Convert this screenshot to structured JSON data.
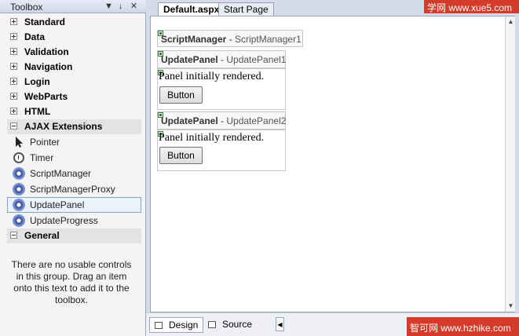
{
  "toolbox": {
    "title": "Toolbox",
    "pin_glyph": "↓",
    "dropdown_glyph": "▼",
    "close_glyph": "✕",
    "categories_top": [
      "Standard",
      "Data",
      "Validation",
      "Navigation",
      "Login",
      "WebParts",
      "HTML"
    ],
    "open_category": "AJAX Extensions",
    "items": [
      "Pointer",
      "Timer",
      "ScriptManager",
      "ScriptManagerProxy",
      "UpdatePanel",
      "UpdateProgress"
    ],
    "selected_item": "UpdatePanel",
    "general_category": "General",
    "empty_message": "There are no usable controls in this group. Drag an item onto this text to add it to the toolbox."
  },
  "tabs": [
    "Default.aspx",
    "Start Page"
  ],
  "watermark_top": "学网  www.xue5.com",
  "designer": {
    "script_manager": {
      "type": "ScriptManager",
      "name": "ScriptManager1"
    },
    "update_panels": [
      {
        "type": "UpdatePanel",
        "name": "UpdatePanel1",
        "text": "Panel initially rendered.",
        "button": "Button"
      },
      {
        "type": "UpdatePanel",
        "name": "UpdatePanel2",
        "text": "Panel initially rendered.",
        "button": "Button"
      }
    ],
    "separator": " - "
  },
  "bottom": {
    "design_label": "Design",
    "source_label": "Source",
    "nav_glyph": "◀"
  },
  "watermark_bottom": "智可网  www.hzhike.com",
  "colors": {
    "watermark": "#d43b2a",
    "selection_border": "#7da2ce"
  }
}
